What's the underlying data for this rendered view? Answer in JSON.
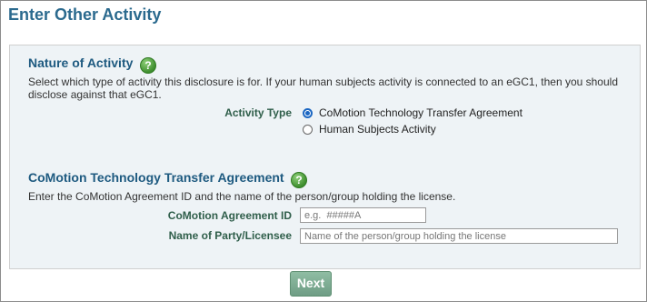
{
  "page_title": "Enter Other Activity",
  "nature": {
    "title": "Nature of Activity",
    "help_icon": "?",
    "description": "Select which type of activity this disclosure is for. If your human subjects activity is connected to an eGC1, then you should disclose against that eGC1.",
    "activity_type_label": "Activity Type",
    "options": [
      {
        "label": "CoMotion Technology Transfer Agreement",
        "checked": true
      },
      {
        "label": "Human Subjects Activity",
        "checked": false
      }
    ]
  },
  "agreement": {
    "title": "CoMotion Technology Transfer Agreement",
    "help_icon": "?",
    "description": "Enter the CoMotion Agreement ID and the name of the person/group holding the license.",
    "agreement_id_label": "CoMotion Agreement ID",
    "agreement_id_placeholder": "e.g.  #####A",
    "party_label": "Name of Party/Licensee",
    "party_placeholder": "Name of the person/group holding the license"
  },
  "next_label": "Next",
  "colors": {
    "title": "#2b6a8e",
    "section_title": "#1e5a80",
    "panel_bg": "#eef3f6",
    "next_button": "#7fae94",
    "radio_accent": "#1a66c2"
  }
}
